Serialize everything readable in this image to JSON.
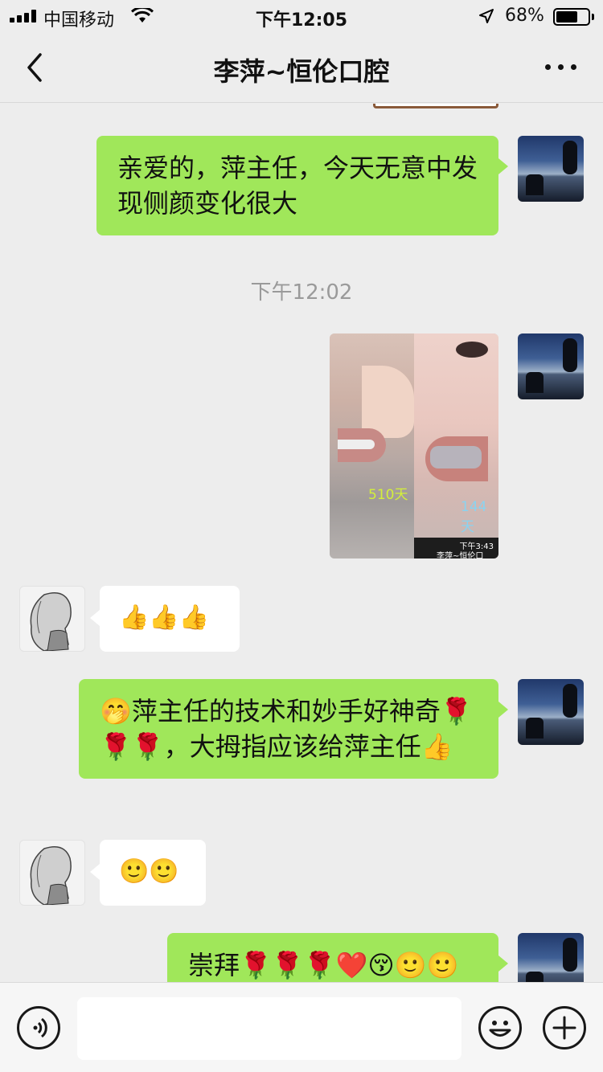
{
  "status_bar": {
    "carrier": "中国移动",
    "time": "下午12:05",
    "battery_percent": "68%",
    "battery_level": 0.68,
    "icons": [
      "signal-icon",
      "wifi-icon",
      "location-icon",
      "battery-icon"
    ]
  },
  "nav": {
    "title": "李萍~恒伦口腔",
    "back_icon": "chevron-left-icon",
    "more_icon": "ellipsis-icon"
  },
  "messages": [
    {
      "sender": "me",
      "text": "亲爱的，萍主任，今天无意中发现侧颜变化很大"
    },
    {
      "timestamp": "下午12:02"
    },
    {
      "sender": "me",
      "type": "image",
      "labels": {
        "left": "510天",
        "right": "144天",
        "phone_time": "下午3:43",
        "phone_title": "李萍~恒伦口"
      }
    },
    {
      "sender": "other",
      "text": "👍👍👍"
    },
    {
      "sender": "me",
      "text": "🤭萍主任的技术和妙手好神奇🌹🌹🌹，大拇指应该给萍主任👍"
    },
    {
      "sender": "other",
      "text": "🙂🙂"
    },
    {
      "sender": "me",
      "text": "崇拜🌹🌹🌹❤️😚🙂🙂"
    }
  ],
  "input_bar": {
    "voice_icon": "voice-icon",
    "emoji_icon": "emoji-icon",
    "plus_icon": "plus-icon",
    "placeholder": ""
  },
  "colors": {
    "background": "#ededed",
    "my_bubble": "#a0e75a",
    "other_bubble": "#ffffff"
  }
}
